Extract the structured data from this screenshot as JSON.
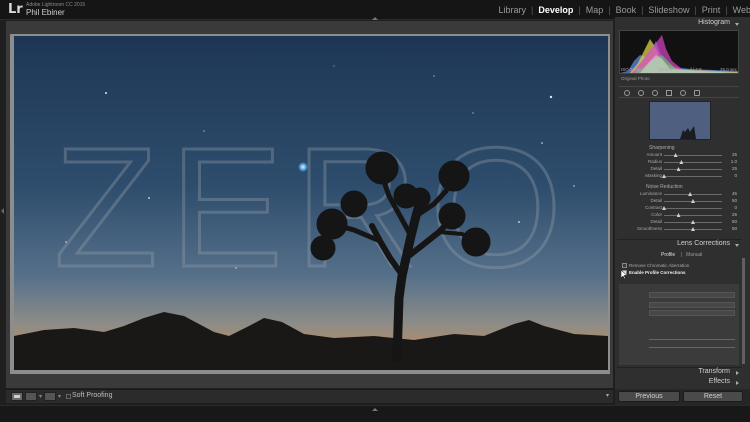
{
  "app": {
    "logo": "Lr",
    "version": "Adobe Lightroom CC 2015",
    "user": "Phil Ebiner"
  },
  "modules": [
    "Library",
    "Develop",
    "Map",
    "Book",
    "Slideshow",
    "Print",
    "Web"
  ],
  "active_module": "Develop",
  "photo": {
    "watermark": "ZERO"
  },
  "toolbar": {
    "soft_proofing": "Soft Proofing"
  },
  "right_panel": {
    "histogram_title": "Histogram",
    "readout": [
      "ISO 3200",
      "24 mm",
      "f / 2.8",
      "25.0 sec"
    ],
    "original_photo": "Original Photo",
    "sharpening": {
      "title": "Sharpening",
      "sliders": [
        {
          "label": "Amount",
          "value": "25",
          "pos": 0.2
        },
        {
          "label": "Radius",
          "value": "1.0",
          "pos": 0.3
        },
        {
          "label": "Detail",
          "value": "25",
          "pos": 0.25
        },
        {
          "label": "Masking",
          "value": "0",
          "pos": 0.0
        }
      ]
    },
    "noise_reduction": {
      "title": "Noise Reduction",
      "sliders": [
        {
          "label": "Luminance",
          "value": "45",
          "pos": 0.45
        },
        {
          "label": "Detail",
          "value": "50",
          "pos": 0.5
        },
        {
          "label": "Contrast",
          "value": "0",
          "pos": 0.0
        },
        {
          "label": "Color",
          "value": "25",
          "pos": 0.25
        },
        {
          "label": "Detail",
          "value": "50",
          "pos": 0.5
        },
        {
          "label": "Smoothness",
          "value": "50",
          "pos": 0.5
        }
      ]
    },
    "lens_corrections_title": "Lens Corrections",
    "lens_tabs": [
      "Profile",
      "Manual"
    ],
    "remove_ca_label": "Remove Chromatic Aberration",
    "enable_profile_label": "Enable Profile Corrections",
    "transform_title": "Transform",
    "effects_title": "Effects",
    "previous_label": "Previous",
    "reset_label": "Reset"
  }
}
